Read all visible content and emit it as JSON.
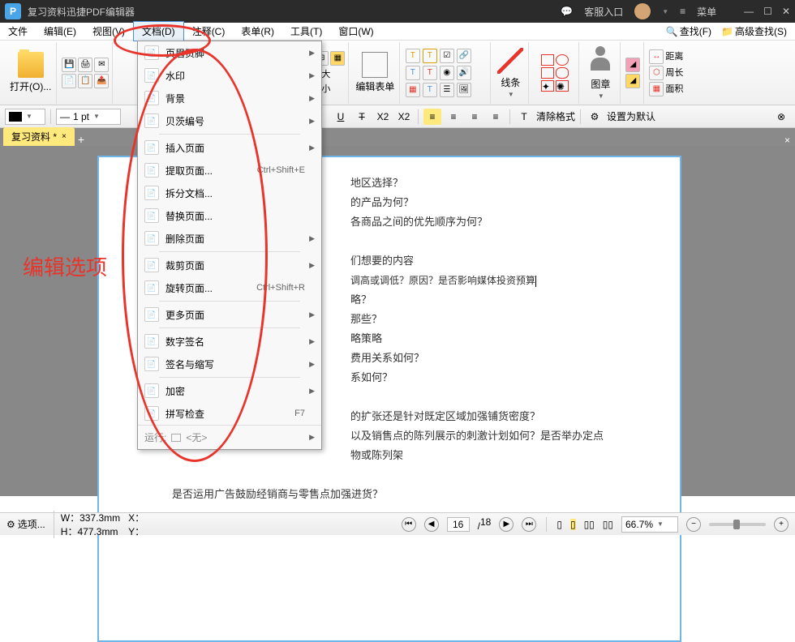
{
  "window": {
    "title": "复习资料迅捷PDF编辑器",
    "customer": "客服入口",
    "menu": "菜单"
  },
  "menubar": {
    "file": "文件",
    "edit": "编辑(E)",
    "view": "视图(V)",
    "doc": "文档(D)",
    "annot": "注释(C)",
    "form": "表单(R)",
    "tool": "工具(T)",
    "window": "窗口(W)",
    "find": "查找(F)",
    "advfind": "高级查找(S)"
  },
  "ribbon": {
    "open": "打开(O)...",
    "editform": "编辑表单",
    "line": "线条",
    "layer": "图章",
    "dist": "距离",
    "perim": "周长",
    "area": "面积"
  },
  "toolbar": {
    "pt": "1 pt",
    "clearfmt": "清除格式",
    "setdefault": "设置为默认"
  },
  "tab": {
    "name": "复习资料 *"
  },
  "dropdown": {
    "items": [
      {
        "label": "页眉页脚",
        "arrow": true
      },
      {
        "label": "水印",
        "arrow": true
      },
      {
        "label": "背景",
        "arrow": true
      },
      {
        "label": "贝茨编号",
        "arrow": true
      },
      {
        "sep": true
      },
      {
        "label": "插入页面",
        "arrow": true
      },
      {
        "label": "提取页面...",
        "shortcut": "Ctrl+Shift+E"
      },
      {
        "label": "拆分文档..."
      },
      {
        "label": "替换页面..."
      },
      {
        "label": "删除页面",
        "arrow": true
      },
      {
        "sep": true
      },
      {
        "label": "裁剪页面",
        "arrow": true
      },
      {
        "label": "旋转页面...",
        "shortcut": "Ctrl+Shift+R"
      },
      {
        "sep": true
      },
      {
        "label": "更多页面",
        "arrow": true
      },
      {
        "sep": true
      },
      {
        "label": "数字签名",
        "arrow": true
      },
      {
        "label": "签名与缩写",
        "arrow": true
      },
      {
        "sep": true
      },
      {
        "label": "加密",
        "arrow": true
      },
      {
        "label": "拼写检查",
        "shortcut": "F7"
      }
    ],
    "run": "运行:",
    "none": "<无>"
  },
  "page_content": [
    "地区选择？",
    "的产品为何？",
    "各商品之间的优先顺序为何？",
    "",
    "们想要的内容",
    "调高或调低？原因？是否影响媒体投资预算",
    "略？",
    "那些？",
    "略策略",
    "费用关系如何？",
    "系如何？",
    "",
    "的扩张还是针对既定区域加强铺货密度？",
    "以及销售点的陈列展示的刺激计划如何？是否举办定点",
    "物或陈列架",
    "",
    "是否运用广告鼓励经销商与零售点加强进货？"
  ],
  "editopt": "编辑选项",
  "status": {
    "options": "选项...",
    "w": "W：337.3mm",
    "h": "H：477.3mm",
    "x": "X：",
    "y": "Y：",
    "page": "16",
    "total": "18",
    "zoom": "66.7%"
  }
}
